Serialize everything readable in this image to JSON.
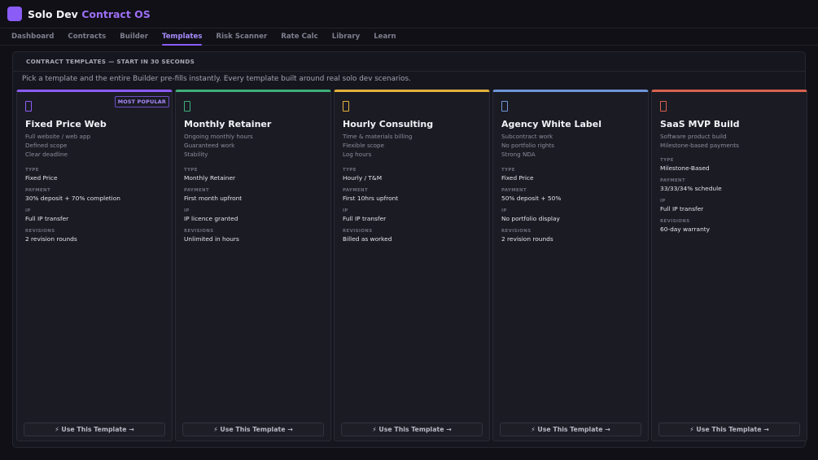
{
  "app": {
    "brand": "Solo Dev",
    "brand_accent": "Contract OS",
    "accent_color": "#8b5cf6"
  },
  "nav": [
    {
      "label": "Dashboard",
      "active": false
    },
    {
      "label": "Contracts",
      "active": false
    },
    {
      "label": "Builder",
      "active": false
    },
    {
      "label": "Templates",
      "active": true
    },
    {
      "label": "Risk Scanner",
      "active": false
    },
    {
      "label": "Rate Calc",
      "active": false
    },
    {
      "label": "Library",
      "active": false
    },
    {
      "label": "Learn",
      "active": false
    }
  ],
  "panel": {
    "icon": "",
    "title": "CONTRACT TEMPLATES — START IN 30 SECONDS",
    "description": "Pick a template and the entire Builder pre-fills instantly. Every template built around real solo dev scenarios."
  },
  "labels": {
    "type": "TYPE",
    "payment": "PAYMENT",
    "ip": "IP",
    "revisions": "REVISIONS",
    "use_button": "⚡ Use This Template →"
  },
  "templates": [
    {
      "title": "Fixed Price Web",
      "color": "#8b5cf6",
      "icon": "document-icon",
      "badge": "MOST POPULAR",
      "features": [
        "Full website / web app",
        "Defined scope",
        "Clear deadline"
      ],
      "type": "Fixed Price",
      "payment": "30% deposit + 70% completion",
      "ip": "Full IP transfer",
      "revisions": "2 revision rounds"
    },
    {
      "title": "Monthly Retainer",
      "color": "#3fae7a",
      "icon": "document-icon",
      "badge": "",
      "features": [
        "Ongoing monthly hours",
        "Guaranteed work",
        "Stability"
      ],
      "type": "Monthly Retainer",
      "payment": "First month upfront",
      "ip": "IP licence granted",
      "revisions": "Unlimited in hours"
    },
    {
      "title": "Hourly Consulting",
      "color": "#e3b23c",
      "icon": "document-icon",
      "badge": "",
      "features": [
        "Time & materials billing",
        "Flexible scope",
        "Log hours"
      ],
      "type": "Hourly / T&M",
      "payment": "First 10hrs upfront",
      "ip": "Full IP transfer",
      "revisions": "Billed as worked"
    },
    {
      "title": "Agency White Label",
      "color": "#6f95d8",
      "icon": "document-icon",
      "badge": "",
      "features": [
        "Subcontract work",
        "No portfolio rights",
        "Strong NDA"
      ],
      "type": "Fixed Price",
      "payment": "50% deposit + 50%",
      "ip": "No portfolio display",
      "revisions": "2 revision rounds"
    },
    {
      "title": "SaaS MVP Build",
      "color": "#d9624f",
      "icon": "document-icon",
      "badge": "",
      "features": [
        "Software product build",
        "Milestone-based payments"
      ],
      "type": "Milestone-Based",
      "payment": "33/33/34% schedule",
      "ip": "Full IP transfer",
      "revisions": "60-day warranty"
    }
  ]
}
